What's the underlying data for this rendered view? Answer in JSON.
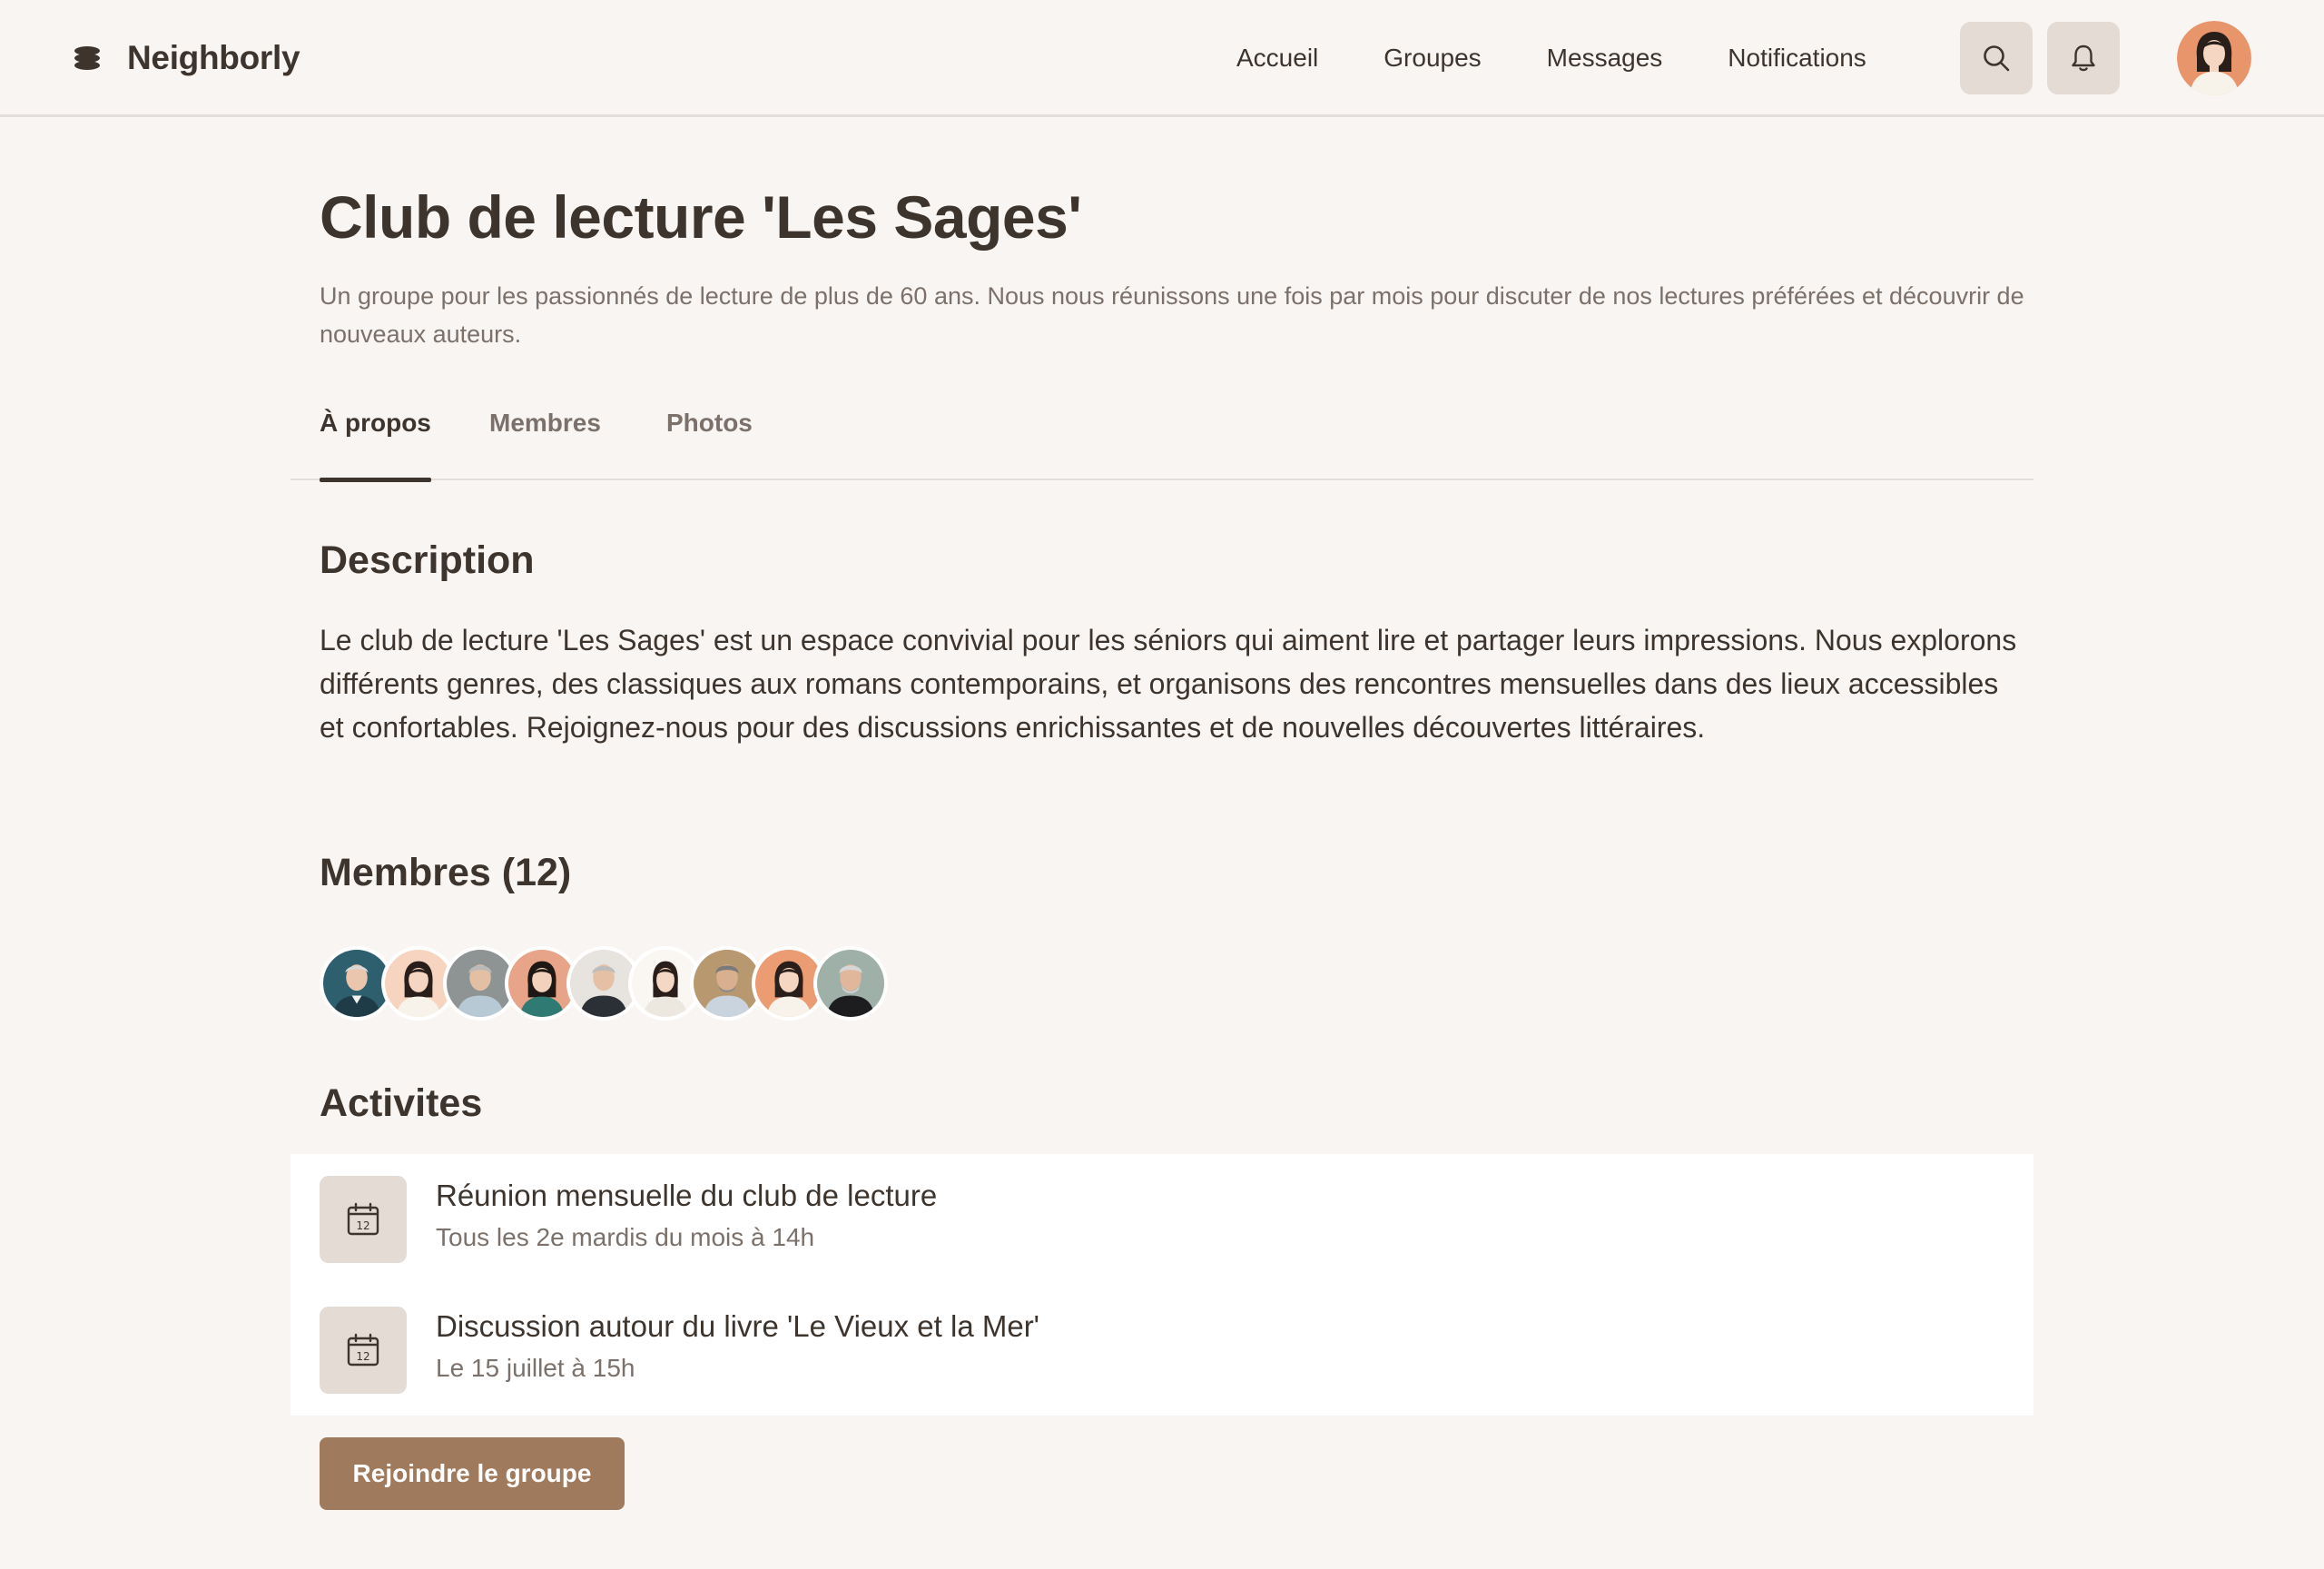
{
  "app": {
    "name": "Neighborly",
    "logo_icon": "stack-icon"
  },
  "nav": {
    "items": [
      {
        "label": "Accueil"
      },
      {
        "label": "Groupes"
      },
      {
        "label": "Messages"
      },
      {
        "label": "Notifications"
      }
    ],
    "search_icon": "search-icon",
    "bell_icon": "bell-icon"
  },
  "group": {
    "title": "Club de lecture 'Les Sages'",
    "subtitle": "Un groupe pour les passionnés de lecture de plus de 60 ans. Nous nous réunissons une fois par mois pour discuter de nos lectures préférées et découvrir de nouveaux auteurs."
  },
  "tabs": [
    {
      "label": "À propos",
      "active": true
    },
    {
      "label": "Membres",
      "active": false
    },
    {
      "label": "Photos",
      "active": false
    }
  ],
  "description": {
    "heading": "Description",
    "text": "Le club de lecture 'Les Sages' est un espace convivial pour les séniors qui aiment lire et partager leurs impressions. Nous explorons différents genres, des classiques aux romans contemporains, et organisons des rencontres mensuelles dans des lieux accessibles et confortables. Rejoignez-nous pour des discussions enrichissantes et de nouvelles découvertes littéraires."
  },
  "members": {
    "heading": "Membres (12)",
    "shown_avatars": 9
  },
  "activities": {
    "heading": "Activites",
    "items": [
      {
        "title": "Réunion mensuelle du club de lecture",
        "subtitle": "Tous les 2e mardis du mois à 14h",
        "icon": "calendar-icon"
      },
      {
        "title": "Discussion autour du livre 'Le Vieux et la Mer'",
        "subtitle": "Le 15 juillet à 15h",
        "icon": "calendar-icon"
      }
    ]
  },
  "cta": {
    "join_label": "Rejoindre le groupe"
  },
  "colors": {
    "background": "#f8f5f2",
    "text": "#3d342d",
    "muted": "#7b716a",
    "icon_tile": "#e3dbd4",
    "accent": "#a07a5c",
    "card": "#ffffff"
  }
}
